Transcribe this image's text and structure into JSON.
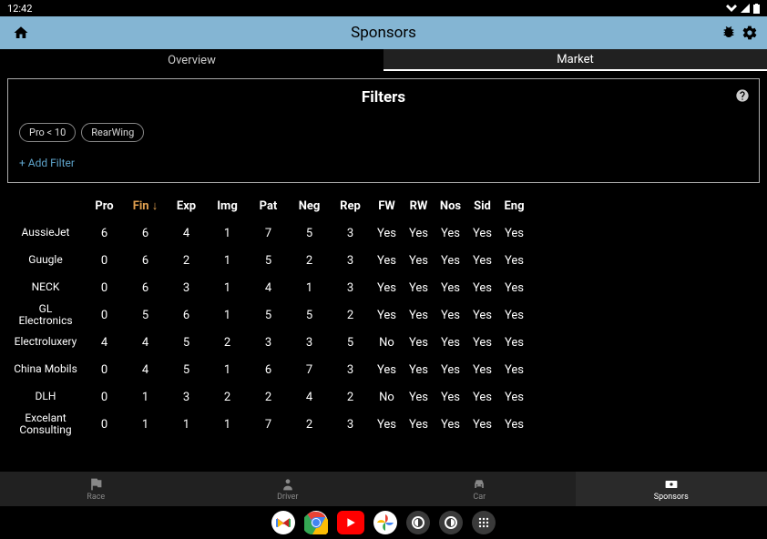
{
  "status": {
    "time": "12:42"
  },
  "appbar": {
    "title": "Sponsors"
  },
  "tabs": [
    {
      "label": "Overview",
      "active": false
    },
    {
      "label": "Market",
      "active": true
    }
  ],
  "filters": {
    "title": "Filters",
    "chips": [
      "Pro < 10",
      "RearWing"
    ],
    "add_label": "+ Add Filter"
  },
  "table": {
    "headers": [
      "Pro",
      "Fin",
      "Exp",
      "Img",
      "Pat",
      "Neg",
      "Rep",
      "FW",
      "RW",
      "Nos",
      "Sid",
      "Eng"
    ],
    "sorted_col": "Fin",
    "rows": [
      {
        "name": "AussieJet",
        "vals": [
          "6",
          "6",
          "4",
          "1",
          "7",
          "5",
          "3",
          "Yes",
          "Yes",
          "Yes",
          "Yes",
          "Yes"
        ]
      },
      {
        "name": "Guugle",
        "vals": [
          "0",
          "6",
          "2",
          "1",
          "5",
          "2",
          "3",
          "Yes",
          "Yes",
          "Yes",
          "Yes",
          "Yes"
        ]
      },
      {
        "name": "NECK",
        "vals": [
          "0",
          "6",
          "3",
          "1",
          "4",
          "1",
          "3",
          "Yes",
          "Yes",
          "Yes",
          "Yes",
          "Yes"
        ]
      },
      {
        "name": "GL Electronics",
        "vals": [
          "0",
          "5",
          "6",
          "1",
          "5",
          "5",
          "2",
          "Yes",
          "Yes",
          "Yes",
          "Yes",
          "Yes"
        ]
      },
      {
        "name": "Electroluxery",
        "vals": [
          "4",
          "4",
          "5",
          "2",
          "3",
          "3",
          "5",
          "No",
          "Yes",
          "Yes",
          "Yes",
          "Yes"
        ]
      },
      {
        "name": "China Mobils",
        "vals": [
          "0",
          "4",
          "5",
          "1",
          "6",
          "7",
          "3",
          "Yes",
          "Yes",
          "Yes",
          "Yes",
          "Yes"
        ]
      },
      {
        "name": "DLH",
        "vals": [
          "0",
          "1",
          "3",
          "2",
          "2",
          "4",
          "2",
          "No",
          "Yes",
          "Yes",
          "Yes",
          "Yes"
        ]
      },
      {
        "name": "Excelant Consulting",
        "vals": [
          "0",
          "1",
          "1",
          "1",
          "7",
          "2",
          "3",
          "Yes",
          "Yes",
          "Yes",
          "Yes",
          "Yes"
        ]
      }
    ]
  },
  "bottomnav": [
    {
      "label": "Race",
      "icon": "flag"
    },
    {
      "label": "Driver",
      "icon": "person"
    },
    {
      "label": "Car",
      "icon": "car"
    },
    {
      "label": "Sponsors",
      "icon": "money",
      "active": true
    }
  ]
}
